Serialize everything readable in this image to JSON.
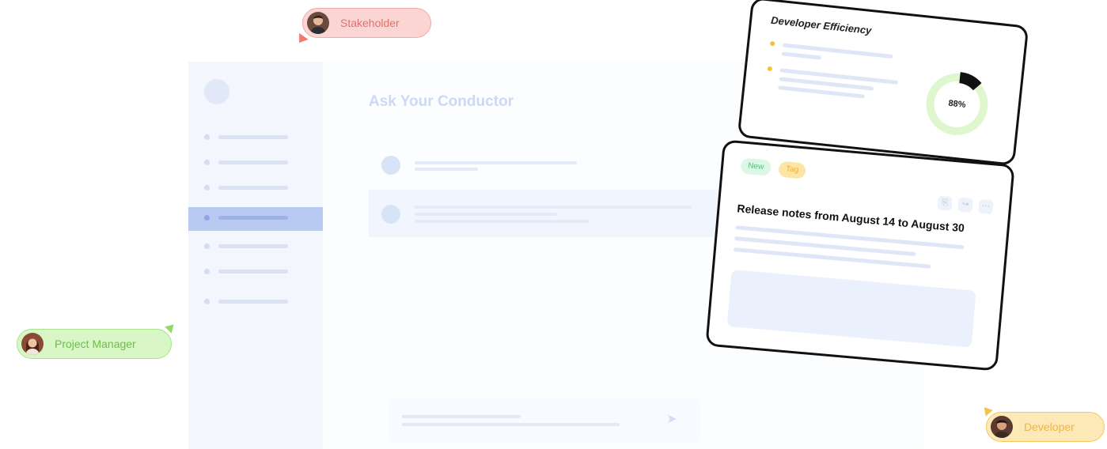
{
  "roles": {
    "stakeholder": "Stakeholder",
    "project_manager": "Project Manager",
    "developer": "Developer"
  },
  "app": {
    "title": "Ask Your Conductor"
  },
  "efficiency_card": {
    "title": "Developer Efficiency",
    "percent_label": "88%",
    "progress": 0.88
  },
  "notes_card": {
    "badges": [
      "New",
      "Tag"
    ],
    "title": "Release notes from August 14 to August 30"
  },
  "colors": {
    "stakeholder": "#f07a73",
    "project_manager": "#8fda68",
    "developer": "#f3c347",
    "accent": "#9cb2ea"
  }
}
